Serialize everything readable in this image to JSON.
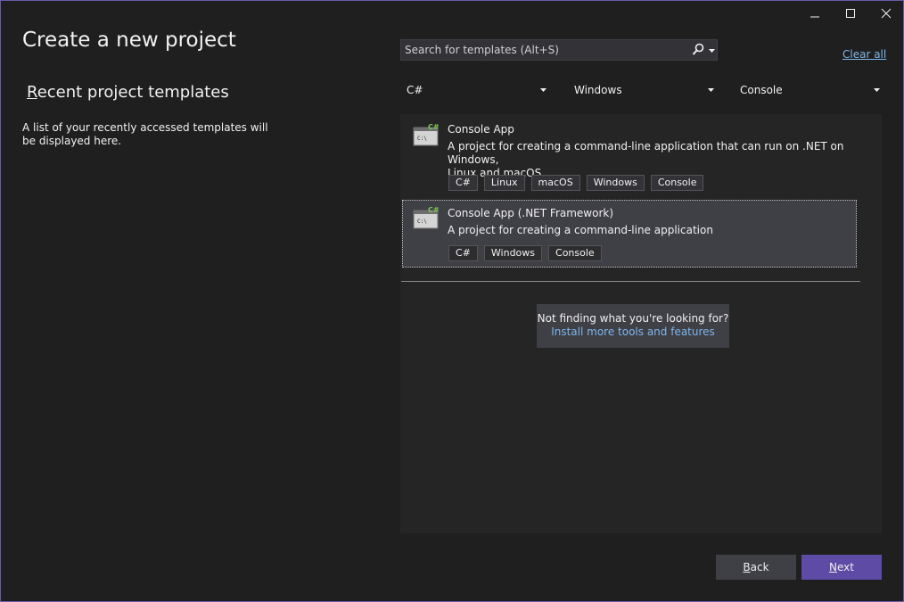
{
  "page_title": "Create a new project",
  "recent": {
    "heading_key": "R",
    "heading_rest": "ecent project templates",
    "description": "A list of your recently accessed templates will be displayed here."
  },
  "search": {
    "placeholder": "Search for templates (Alt+S)"
  },
  "clear_all": "Clear all",
  "filters": {
    "language": "C#",
    "platform": "Windows",
    "project_type": "Console"
  },
  "templates": [
    {
      "title": "Console App",
      "desc_line1": "A project for creating a command-line application that can run on .NET on Windows,",
      "desc_line2": "Linux and macOS",
      "tags": [
        "C#",
        "Linux",
        "macOS",
        "Windows",
        "Console"
      ],
      "badge": "C#",
      "icon_text": "C:\\"
    },
    {
      "title": "Console App (.NET Framework)",
      "desc_line1": "A project for creating a command-line application",
      "tags": [
        "C#",
        "Windows",
        "Console"
      ],
      "badge": "C#",
      "icon_text": "C:\\"
    }
  ],
  "not_finding": {
    "question": "Not finding what you're looking for?",
    "link": "Install more tools and features"
  },
  "buttons": {
    "back_key": "B",
    "back_rest": "ack",
    "next_key": "N",
    "next_rest": "ext"
  },
  "colors": {
    "accent": "#5d4ba6",
    "link": "#7fb6ea",
    "background": "#1f1f1f",
    "badge_green": "#7ec856"
  }
}
